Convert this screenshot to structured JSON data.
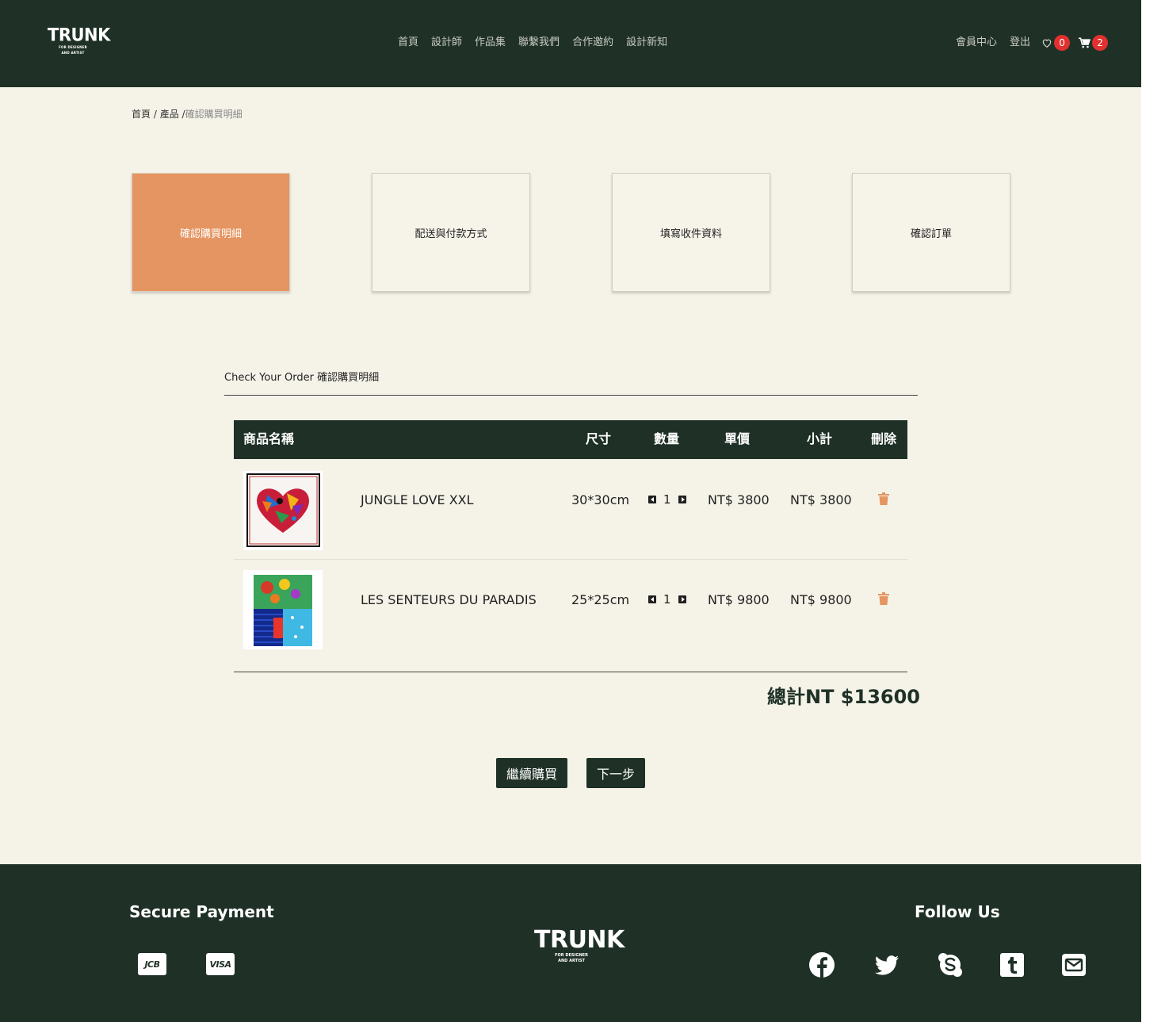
{
  "header": {
    "logo_word": "TRUNK",
    "logo_tag1": "FOR DESIGNER",
    "logo_tag2": "AND ARTIST",
    "nav": [
      "首頁",
      "設計師",
      "作品集",
      "聯繫我們",
      "合作邀約",
      "設計新知"
    ],
    "member_label": "會員中心",
    "logout_label": "登出",
    "wishlist_count": "0",
    "cart_count": "2"
  },
  "breadcrumb": {
    "home": "首頁",
    "sep1": " / ",
    "product": "產品",
    "sep2": " /",
    "current": "確認購買明細"
  },
  "steps": [
    "確認購買明細",
    "配送與付款方式",
    "填寫收件資料",
    "確認訂單"
  ],
  "section_title": "Check Your Order 確認購買明細",
  "table": {
    "headers": {
      "name": "商品名稱",
      "size": "尺寸",
      "qty": "數量",
      "price": "單價",
      "subtotal": "小計",
      "delete": "刪除"
    },
    "rows": [
      {
        "name": "JUNGLE LOVE XXL",
        "size": "30*30cm",
        "qty": "1",
        "price": "NT$ 3800",
        "subtotal": "NT$ 3800"
      },
      {
        "name": "LES SENTEURS DU PARADIS",
        "size": "25*25cm",
        "qty": "1",
        "price": "NT$ 9800",
        "subtotal": "NT$ 9800"
      }
    ]
  },
  "total": "總計NT $13600",
  "buttons": {
    "continue": "繼續購買",
    "next": "下一步"
  },
  "footer": {
    "payment_title": "Secure Payment",
    "cards": [
      "JCB",
      "VISA"
    ],
    "follow_title": "Follow Us",
    "social": [
      "facebook-icon",
      "twitter-icon",
      "skype-icon",
      "tumblr-icon",
      "email-icon"
    ]
  },
  "colors": {
    "dark_green": "#1f3127",
    "cream": "#f5f3e8",
    "accent_orange": "#e59561",
    "badge_red": "#e0312f"
  }
}
